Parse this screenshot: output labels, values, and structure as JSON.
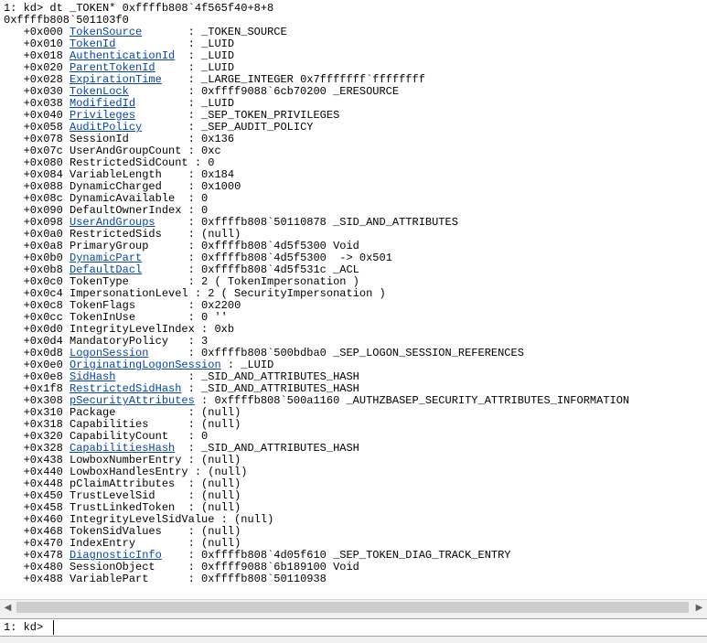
{
  "output": {
    "command_line": "1: kd> dt _TOKEN* 0xffffb808`4f565f40+8+8",
    "address_line": "0xffffb808`501103f0",
    "fields": [
      {
        "off": "   +0x000 ",
        "name": "TokenSource",
        "pad": "      ",
        "link": true,
        "rest": " : _TOKEN_SOURCE"
      },
      {
        "off": "   +0x010 ",
        "name": "TokenId",
        "pad": "          ",
        "link": true,
        "rest": " : _LUID"
      },
      {
        "off": "   +0x018 ",
        "name": "AuthenticationId",
        "pad": " ",
        "link": true,
        "rest": " : _LUID"
      },
      {
        "off": "   +0x020 ",
        "name": "ParentTokenId",
        "pad": "    ",
        "link": true,
        "rest": " : _LUID"
      },
      {
        "off": "   +0x028 ",
        "name": "ExpirationTime",
        "pad": "   ",
        "link": true,
        "rest": " : _LARGE_INTEGER 0x7fffffff`ffffffff"
      },
      {
        "off": "   +0x030 ",
        "name": "TokenLock",
        "pad": "        ",
        "link": true,
        "rest": " : 0xffff9088`6cb70200 _ERESOURCE"
      },
      {
        "off": "   +0x038 ",
        "name": "ModifiedId",
        "pad": "       ",
        "link": true,
        "rest": " : _LUID"
      },
      {
        "off": "   +0x040 ",
        "name": "Privileges",
        "pad": "       ",
        "link": true,
        "rest": " : _SEP_TOKEN_PRIVILEGES"
      },
      {
        "off": "   +0x058 ",
        "name": "AuditPolicy",
        "pad": "      ",
        "link": true,
        "rest": " : _SEP_AUDIT_POLICY"
      },
      {
        "off": "   +0x078 ",
        "name": "SessionId",
        "pad": "        ",
        "link": false,
        "rest": " : 0x136"
      },
      {
        "off": "   +0x07c ",
        "name": "UserAndGroupCount",
        "pad": "",
        "link": false,
        "rest": " : 0xc"
      },
      {
        "off": "   +0x080 ",
        "name": "RestrictedSidCount",
        "pad": "",
        "link": false,
        "rest": " : 0"
      },
      {
        "off": "   +0x084 ",
        "name": "VariableLength",
        "pad": "   ",
        "link": false,
        "rest": " : 0x184"
      },
      {
        "off": "   +0x088 ",
        "name": "DynamicCharged",
        "pad": "   ",
        "link": false,
        "rest": " : 0x1000"
      },
      {
        "off": "   +0x08c ",
        "name": "DynamicAvailable",
        "pad": " ",
        "link": false,
        "rest": " : 0"
      },
      {
        "off": "   +0x090 ",
        "name": "DefaultOwnerIndex",
        "pad": "",
        "link": false,
        "rest": " : 0"
      },
      {
        "off": "   +0x098 ",
        "name": "UserAndGroups",
        "pad": "    ",
        "link": true,
        "rest": " : 0xffffb808`50110878 _SID_AND_ATTRIBUTES"
      },
      {
        "off": "   +0x0a0 ",
        "name": "RestrictedSids",
        "pad": "   ",
        "link": false,
        "rest": " : (null)"
      },
      {
        "off": "   +0x0a8 ",
        "name": "PrimaryGroup",
        "pad": "     ",
        "link": false,
        "rest": " : 0xffffb808`4d5f5300 Void"
      },
      {
        "off": "   +0x0b0 ",
        "name": "DynamicPart",
        "pad": "      ",
        "link": true,
        "rest": " : 0xffffb808`4d5f5300  -> 0x501"
      },
      {
        "off": "   +0x0b8 ",
        "name": "DefaultDacl",
        "pad": "      ",
        "link": true,
        "rest": " : 0xffffb808`4d5f531c _ACL"
      },
      {
        "off": "   +0x0c0 ",
        "name": "TokenType",
        "pad": "        ",
        "link": false,
        "rest": " : 2 ( TokenImpersonation )"
      },
      {
        "off": "   +0x0c4 ",
        "name": "ImpersonationLevel",
        "pad": "",
        "link": false,
        "rest": " : 2 ( SecurityImpersonation )"
      },
      {
        "off": "   +0x0c8 ",
        "name": "TokenFlags",
        "pad": "       ",
        "link": false,
        "rest": " : 0x2200"
      },
      {
        "off": "   +0x0cc ",
        "name": "TokenInUse",
        "pad": "       ",
        "link": false,
        "rest": " : 0 ''"
      },
      {
        "off": "   +0x0d0 ",
        "name": "IntegrityLevelIndex",
        "pad": "",
        "link": false,
        "rest": " : 0xb"
      },
      {
        "off": "   +0x0d4 ",
        "name": "MandatoryPolicy",
        "pad": "  ",
        "link": false,
        "rest": " : 3"
      },
      {
        "off": "   +0x0d8 ",
        "name": "LogonSession",
        "pad": "     ",
        "link": true,
        "rest": " : 0xffffb808`500bdba0 _SEP_LOGON_SESSION_REFERENCES"
      },
      {
        "off": "   +0x0e0 ",
        "name": "OriginatingLogonSession",
        "pad": "",
        "link": true,
        "rest": " : _LUID"
      },
      {
        "off": "   +0x0e8 ",
        "name": "SidHash",
        "pad": "          ",
        "link": true,
        "rest": " : _SID_AND_ATTRIBUTES_HASH"
      },
      {
        "off": "   +0x1f8 ",
        "name": "RestrictedSidHash",
        "pad": "",
        "link": true,
        "rest": " : _SID_AND_ATTRIBUTES_HASH"
      },
      {
        "off": "   +0x308 ",
        "name": "pSecurityAttributes",
        "pad": "",
        "link": true,
        "rest": " : 0xffffb808`500a1160 _AUTHZBASEP_SECURITY_ATTRIBUTES_INFORMATION"
      },
      {
        "off": "   +0x310 ",
        "name": "Package",
        "pad": "          ",
        "link": false,
        "rest": " : (null)"
      },
      {
        "off": "   +0x318 ",
        "name": "Capabilities",
        "pad": "     ",
        "link": false,
        "rest": " : (null)"
      },
      {
        "off": "   +0x320 ",
        "name": "CapabilityCount",
        "pad": "  ",
        "link": false,
        "rest": " : 0"
      },
      {
        "off": "   +0x328 ",
        "name": "CapabilitiesHash",
        "pad": " ",
        "link": true,
        "rest": " : _SID_AND_ATTRIBUTES_HASH"
      },
      {
        "off": "   +0x438 ",
        "name": "LowboxNumberEntry",
        "pad": "",
        "link": false,
        "rest": " : (null)"
      },
      {
        "off": "   +0x440 ",
        "name": "LowboxHandlesEntry",
        "pad": "",
        "link": false,
        "rest": " : (null)"
      },
      {
        "off": "   +0x448 ",
        "name": "pClaimAttributes",
        "pad": " ",
        "link": false,
        "rest": " : (null)"
      },
      {
        "off": "   +0x450 ",
        "name": "TrustLevelSid",
        "pad": "    ",
        "link": false,
        "rest": " : (null)"
      },
      {
        "off": "   +0x458 ",
        "name": "TrustLinkedToken",
        "pad": " ",
        "link": false,
        "rest": " : (null)"
      },
      {
        "off": "   +0x460 ",
        "name": "IntegrityLevelSidValue",
        "pad": "",
        "link": false,
        "rest": " : (null)"
      },
      {
        "off": "   +0x468 ",
        "name": "TokenSidValues",
        "pad": "   ",
        "link": false,
        "rest": " : (null)"
      },
      {
        "off": "   +0x470 ",
        "name": "IndexEntry",
        "pad": "       ",
        "link": false,
        "rest": " : (null)"
      },
      {
        "off": "   +0x478 ",
        "name": "DiagnosticInfo",
        "pad": "   ",
        "link": true,
        "rest": " : 0xffffb808`4d05f610 _SEP_TOKEN_DIAG_TRACK_ENTRY"
      },
      {
        "off": "   +0x480 ",
        "name": "SessionObject",
        "pad": "    ",
        "link": false,
        "rest": " : 0xffff9088`6b189100 Void"
      },
      {
        "off": "   +0x488 ",
        "name": "VariablePart",
        "pad": "     ",
        "link": false,
        "rest": " : 0xffffb808`50110938"
      }
    ]
  },
  "scrollbar": {
    "left_arrow": "◀",
    "right_arrow": "▶"
  },
  "command": {
    "prompt": "1: kd>",
    "value": ""
  },
  "colors": {
    "link": "#0645ad",
    "chrome": "#f0f0f0"
  }
}
